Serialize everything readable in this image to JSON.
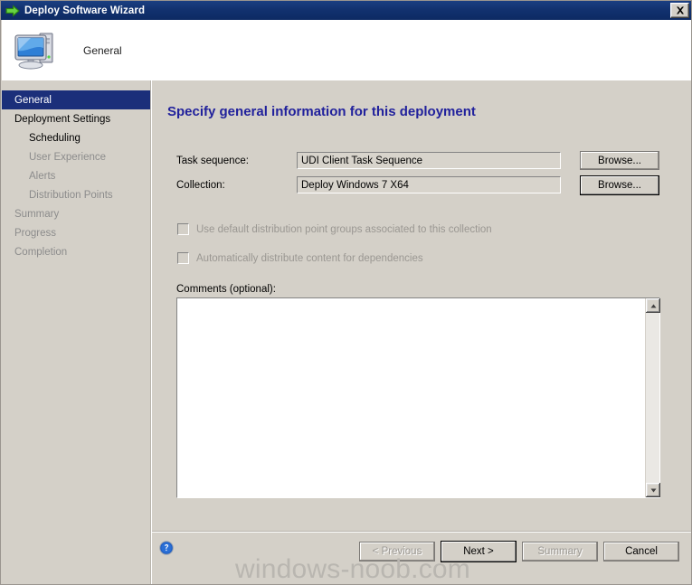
{
  "window": {
    "title": "Deploy Software Wizard",
    "title_icon": "green-right-arrow-icon",
    "close_label": "X",
    "accent_titlebar": "#12326f"
  },
  "header": {
    "icon": "computer-icon",
    "caption": "General"
  },
  "sidebar": {
    "items": [
      {
        "label": "General",
        "state": "selected",
        "indent": false
      },
      {
        "label": "Deployment Settings",
        "state": "active",
        "indent": false
      },
      {
        "label": "Scheduling",
        "state": "active",
        "indent": true
      },
      {
        "label": "User Experience",
        "state": "disabled",
        "indent": true
      },
      {
        "label": "Alerts",
        "state": "disabled",
        "indent": true
      },
      {
        "label": "Distribution Points",
        "state": "disabled",
        "indent": true
      },
      {
        "label": "Summary",
        "state": "disabled",
        "indent": false
      },
      {
        "label": "Progress",
        "state": "disabled",
        "indent": false
      },
      {
        "label": "Completion",
        "state": "disabled",
        "indent": false
      }
    ]
  },
  "content": {
    "heading": "Specify general information for this deployment",
    "heading_color": "#21219c",
    "fields": [
      {
        "label": "Task sequence:",
        "value": "UDI Client Task Sequence",
        "browse_label": "Browse...",
        "focused": false
      },
      {
        "label": "Collection:",
        "value": "Deploy Windows 7 X64",
        "browse_label": "Browse...",
        "focused": true
      }
    ],
    "checkboxes": [
      {
        "label": "Use default distribution point groups associated to this collection",
        "checked": false,
        "disabled": true
      },
      {
        "label": "Automatically distribute content for dependencies",
        "checked": false,
        "disabled": true
      }
    ],
    "comments": {
      "label": "Comments (optional):",
      "value": "",
      "placeholder": ""
    }
  },
  "footer": {
    "help_icon": "help-circle-icon",
    "buttons": [
      {
        "label": "< Previous",
        "state": "disabled",
        "default": false
      },
      {
        "label": "Next >",
        "state": "enabled",
        "default": true
      },
      {
        "label": "Summary",
        "state": "disabled",
        "default": false
      },
      {
        "label": "Cancel",
        "state": "enabled",
        "default": false
      }
    ]
  },
  "watermark": {
    "text": "windows-noob.com",
    "color": "#b9b6b0"
  }
}
